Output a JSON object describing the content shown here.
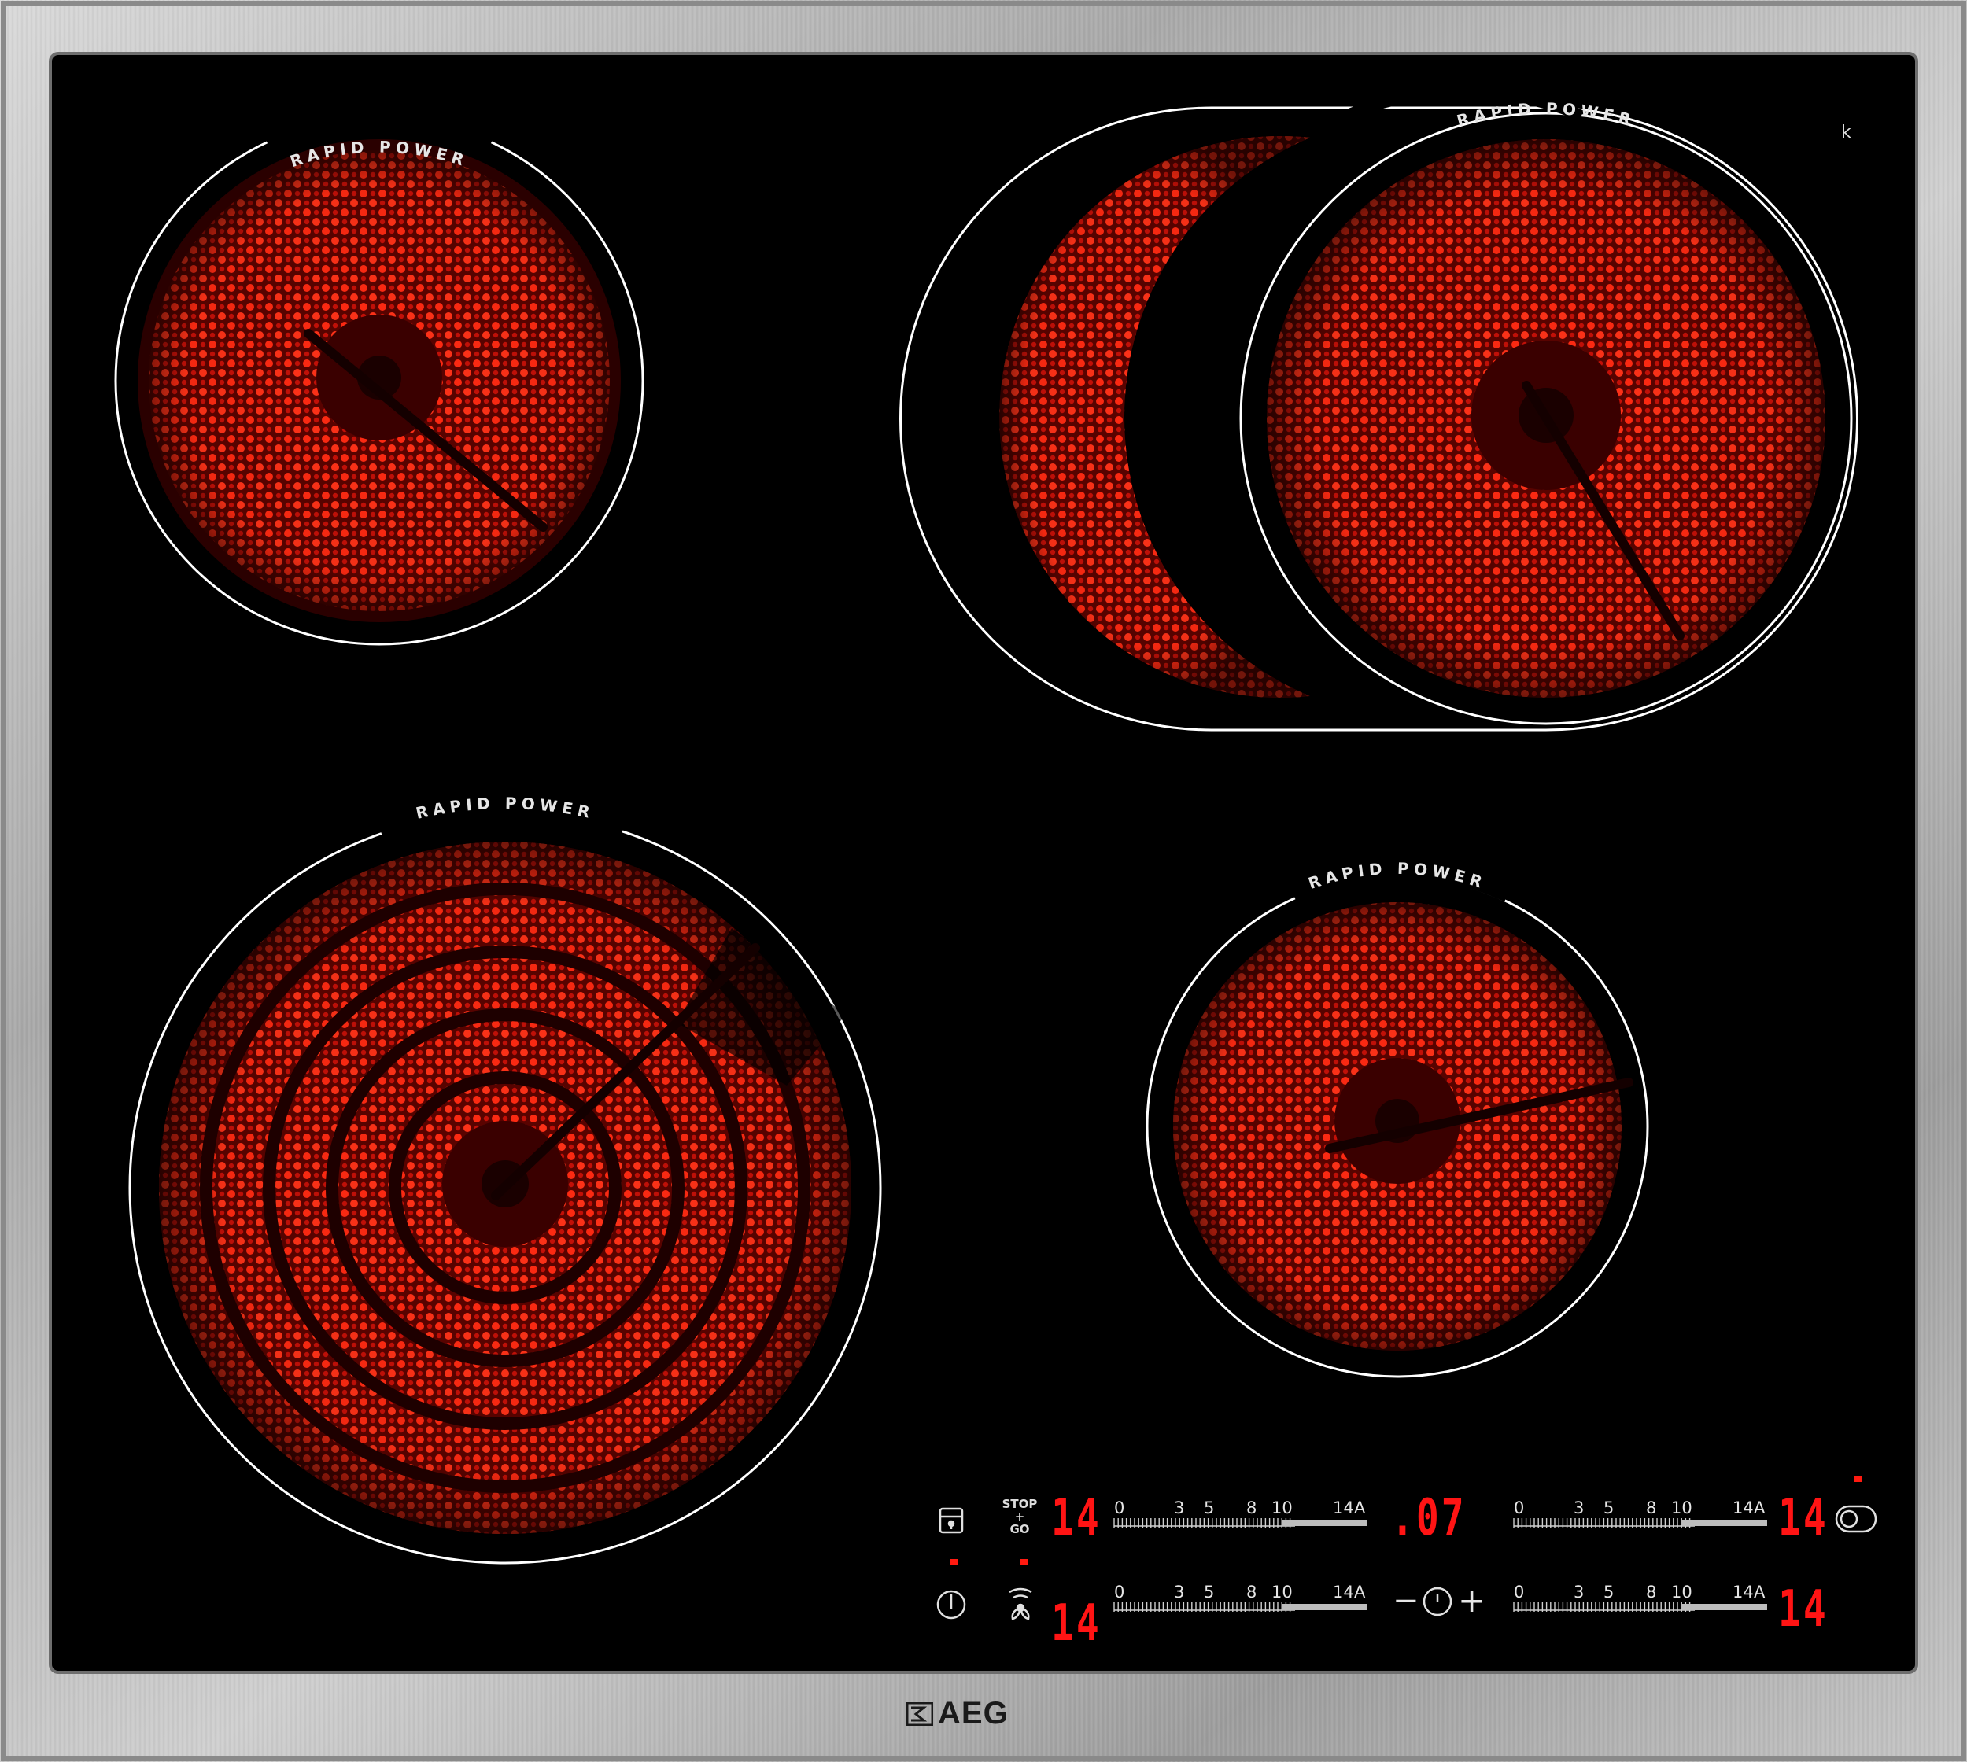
{
  "appliance": {
    "brand": "AEG",
    "badge": "k"
  },
  "zones": [
    {
      "id": "rear-left",
      "label": "RAPID POWER"
    },
    {
      "id": "rear-right-dual",
      "label": "RAPID POWER"
    },
    {
      "id": "front-left",
      "label": "RAPID POWER"
    },
    {
      "id": "front-right",
      "label": "RAPID POWER"
    }
  ],
  "control_panel": {
    "stop_go": {
      "line1": "STOP",
      "line2": "+",
      "line3": "GO"
    },
    "slider_scale": [
      "0",
      "3",
      "5",
      "8",
      "10",
      "14",
      "A"
    ],
    "displays": {
      "top_left": "14",
      "timer": ".07",
      "top_right": "14",
      "bottom_left": "14",
      "bottom_right": "14"
    },
    "timer_controls": {
      "minus": "−",
      "plus": "+"
    }
  },
  "colors": {
    "frame": "#b8b8b8",
    "glass": "#000000",
    "heat": "#ff2a12",
    "display": "#ff1414"
  }
}
